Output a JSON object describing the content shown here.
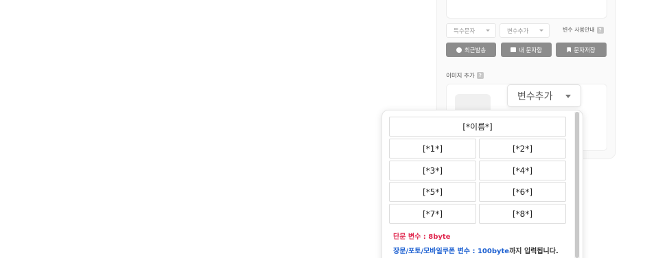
{
  "editor": {
    "special_chars_label": "특수문자",
    "var_add_small_label": "변수추가",
    "var_guide_label": "변수 사용안내",
    "help_icon": "?"
  },
  "buttons": {
    "recent_label": "최근발송",
    "my_messages_label": "내 문자함",
    "save_label": "문자저장"
  },
  "image": {
    "label": "이미지 추가"
  },
  "variable_dropdown": {
    "trigger_label": "변수추가",
    "name_var": "[*이름*]",
    "vars": [
      "[*1*]",
      "[*2*]",
      "[*3*]",
      "[*4*]",
      "[*5*]",
      "[*6*]",
      "[*7*]",
      "[*8*]"
    ],
    "short_note_prefix": "단문 변수 : ",
    "short_note_value": "8byte",
    "long_note_prefix": "장문/포토/모바일쿠폰 변수 : ",
    "long_note_value": "100byte",
    "long_note_suffix": "까지 입력됩니다."
  },
  "colors": {
    "short_note": "#e0284f",
    "long_note": "#1b5fd1",
    "button_gray": "#8c8c8c"
  }
}
